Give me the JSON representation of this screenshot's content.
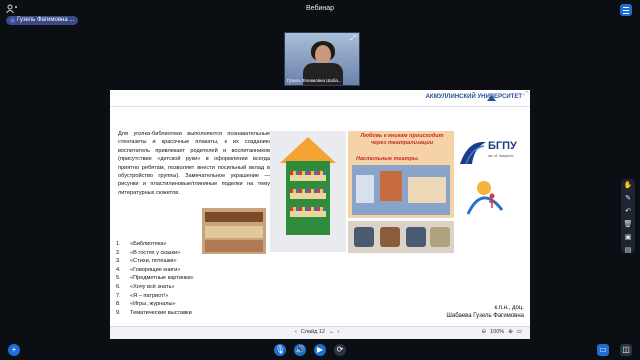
{
  "app": {
    "title": "Вебинар",
    "presenter_chip": "Гузель Фагимовна ..."
  },
  "webcam": {
    "name_label": "Гузель Фагимовна Шаба..."
  },
  "slide": {
    "university_name": "АКМУЛЛИНСКИЙ УНИВЕРСИТЕТ",
    "body": "Для уголка-библиотеки выполняются познавательные стенгазеты и красочные плакаты, к их созданию воспитатель привлекает родителей и воспитанников (присутствие «детской руки» в оформлении всегда приятно ребятам, позволяет внести посильный вклад в обустройство группы). Замечательное украшение — рисунки и пластилиновые/глиняные поделки на тему литературных сюжетов.",
    "photo_caption_1": "Любовь к книгам происходит через театрализации",
    "photo_caption_2": "Настольные театры.",
    "logo_text": "БГПУ",
    "logo_sub": "им. М. Акмуллы",
    "list": [
      {
        "num": "1.",
        "text": "«Библиотека»"
      },
      {
        "num": "2.",
        "text": "«В гостях у сказки»"
      },
      {
        "num": "3.",
        "text": "«Стихи, потешки»"
      },
      {
        "num": "4.",
        "text": "«Говорящие книги»"
      },
      {
        "num": "5.",
        "text": "«Предметные картинки»"
      },
      {
        "num": "6.",
        "text": "«Хочу всё знать»"
      },
      {
        "num": "7.",
        "text": "«Я – патриот!»"
      },
      {
        "num": "8.",
        "text": "«Игры, журналы»"
      },
      {
        "num": "9.",
        "text": "Тематические выставки"
      }
    ],
    "author_line1": "к.п.н., доц.",
    "author_line2": "Шабаева Гузель Фагимовна"
  },
  "slide_controls": {
    "prev": "‹",
    "slide_label": "Слайд 12",
    "dropdown": "⌄",
    "next": "›",
    "zoom_out": "⊖",
    "zoom_value": "100%",
    "zoom_in": "⊕",
    "fit": "▭"
  },
  "icons": {
    "users": "users-icon",
    "menu": "menu-icon",
    "plus": "plus-icon",
    "mic": "microphone-icon",
    "volume": "volume-icon",
    "camera": "camera-icon",
    "share": "share-icon",
    "presentation": "presentation-icon",
    "layout": "layout-icon"
  },
  "colors": {
    "accent": "#1e6fd1",
    "background": "#0b0f14",
    "slide_red": "#c9282d",
    "uni_blue": "#2b4f9a"
  }
}
